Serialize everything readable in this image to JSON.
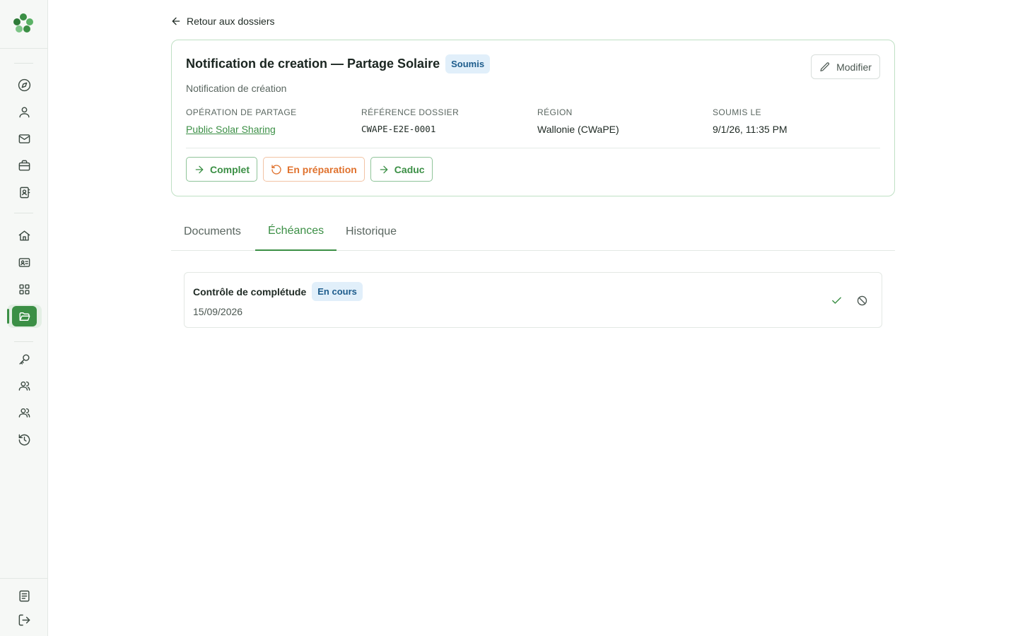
{
  "sidebar": {
    "logo": "clover-logo",
    "groups": [
      [
        "compass-icon",
        "user-icon",
        "mail-icon",
        "briefcase-icon",
        "contact-card-icon"
      ],
      [
        "home-icon",
        "id-card-icon",
        "grid-icon",
        "folder-open-icon"
      ],
      [
        "key-icon",
        "users-icon",
        "users-alt-icon",
        "history-icon"
      ]
    ],
    "bottom": [
      "document-icon",
      "logout-icon"
    ],
    "active": "folder-open-icon"
  },
  "back_link": {
    "label": "Retour aux dossiers"
  },
  "card": {
    "title": "Notification de creation — Partage Solaire",
    "status_badge": "Soumis",
    "subtitle": "Notification de création",
    "edit_label": "Modifier",
    "meta": [
      {
        "label": "OPÉRATION DE PARTAGE",
        "value": "Public Solar Sharing"
      },
      {
        "label": "RÉFÉRENCE DOSSIER",
        "value": "CWAPE-E2E-0001"
      },
      {
        "label": "RÉGION",
        "value": "Wallonie (CWaPE)"
      },
      {
        "label": "SOUMIS LE",
        "value": "9/1/26, 11:35 PM"
      }
    ],
    "actions": [
      {
        "label": "Complet",
        "icon": "arrow-right-icon"
      },
      {
        "label": "En préparation",
        "icon": "rotate-ccw-icon"
      },
      {
        "label": "Caduc",
        "icon": "arrow-right-icon"
      }
    ]
  },
  "tabs": [
    {
      "label": "Documents"
    },
    {
      "label": "Échéances",
      "active": true
    },
    {
      "label": "Historique"
    }
  ],
  "deadlines": [
    {
      "title": "Contrôle de complétude",
      "status": "En cours",
      "date": "15/09/2026"
    }
  ],
  "colors": {
    "accent": "#3b8f45",
    "orange": "#e0722e",
    "badge_blue_bg": "#e1effa",
    "badge_blue_text": "#1d5c8c"
  }
}
